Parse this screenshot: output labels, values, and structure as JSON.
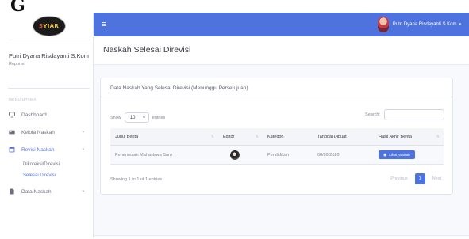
{
  "top_glyph": "G",
  "sidebar": {
    "logo_text": {
      "prefix": "S",
      "rest": "YIAR"
    },
    "user_name": "Putri Dyana Risdayanti S.Kom",
    "user_role": "Reporter",
    "heading": "MENU UTAMA",
    "items": [
      {
        "label": "Dashboard",
        "icon": "monitor-icon"
      },
      {
        "label": "Kelola Naskah",
        "icon": "card-icon"
      },
      {
        "label": "Revisi Naskah",
        "icon": "calendar-icon"
      },
      {
        "label": "Data Naskah",
        "icon": "file-icon"
      }
    ],
    "revisi_submenu": [
      "Dikoreksi/Direvisi",
      "Selesai Direvisi"
    ]
  },
  "topbar": {
    "menu_icon": "hamburger-icon",
    "user_name": "Putri Dyana Risdayanti S.Kom"
  },
  "page": {
    "title": "Naskah Selesai Direvisi"
  },
  "card": {
    "title": "Data Naskah Yang Selesai Direvisi (Menunggu Persetujuan)",
    "show_label": "Show",
    "entries_label": "entries",
    "page_length": "10",
    "search_label": "Search:",
    "search_value": "",
    "columns": [
      "Judul Berita",
      "Editor",
      "Kategori",
      "Tanggal Dibuat",
      "Hasil Akhir Berita"
    ],
    "rows": [
      {
        "judul": "Penerimaan Mahasiswa Baru",
        "kategori": "Pendidikan",
        "tanggal": "08/09/2020",
        "action_label": "Lihat Naskah"
      }
    ],
    "info": "Showing 1 to 1 of 1 entries",
    "pagination": {
      "previous": "Previous",
      "current": "1",
      "next": "Next"
    }
  },
  "colors": {
    "primary": "#4e73df",
    "sidebar_active": "#4e73df",
    "text_muted": "#858796"
  }
}
